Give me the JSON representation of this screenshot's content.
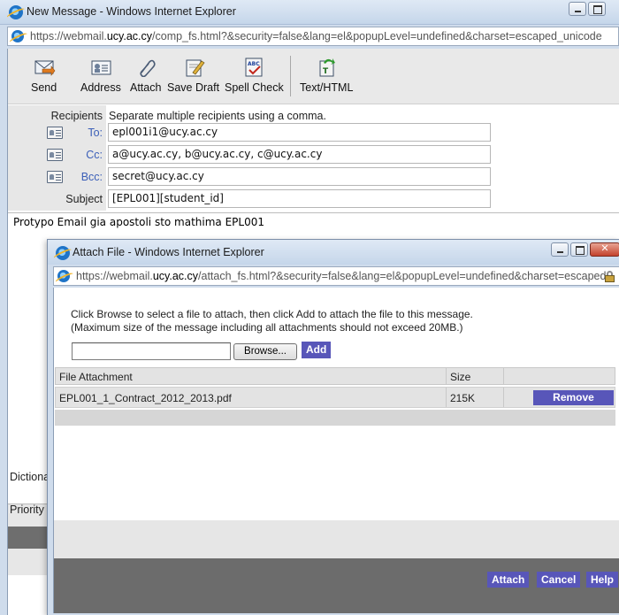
{
  "main_window": {
    "title": "New Message - Windows Internet Explorer",
    "url_prefix": "https://webmail.",
    "url_domain": "ucy.ac.cy",
    "url_rest": "/comp_fs.html?&security=false&lang=el&popupLevel=undefined&charset=escaped_unicode"
  },
  "toolbar": {
    "send": "Send",
    "address": "Address",
    "attach": "Attach",
    "save_draft": "Save Draft",
    "spell_check": "Spell Check",
    "text_html": "Text/HTML"
  },
  "compose": {
    "recipients_label": "Recipients",
    "recipients_hint": "Separate multiple recipients using a comma.",
    "to_label": "To:",
    "to_value": "epl001i1@ucy.ac.cy",
    "cc_label": "Cc:",
    "cc_value": "a@ucy.ac.cy, b@ucy.ac.cy, c@ucy.ac.cy",
    "bcc_label": "Bcc:",
    "bcc_value": "secret@ucy.ac.cy",
    "subject_label": "Subject",
    "subject_value": "[EPL001][student_id]",
    "body_text": "Protypo Email gia apostoli sto mathima EPL001",
    "dictionary_label": "Dictiona",
    "priority_label": "Priority"
  },
  "popup": {
    "title": "Attach File - Windows Internet Explorer",
    "url_prefix": "https://webmail.",
    "url_domain": "ucy.ac.cy",
    "url_rest": "/attach_fs.html?&security=false&lang=el&popupLevel=undefined&charset=escaped",
    "instruction_line1": "Click Browse to select a file to attach, then click Add to attach the file to this message.",
    "instruction_line2": "(Maximum size of the message including all attachments should not exceed 20MB.)",
    "file_input_value": "",
    "browse_label": "Browse...",
    "add_label": "Add",
    "table": {
      "columns": [
        "File Attachment",
        "Size"
      ],
      "rows": [
        {
          "file": "EPL001_1_Contract_2012_2013.pdf",
          "size": "215K",
          "action": "Remove"
        }
      ]
    },
    "attach_label": "Attach",
    "cancel_label": "Cancel",
    "help_label": "Help"
  }
}
